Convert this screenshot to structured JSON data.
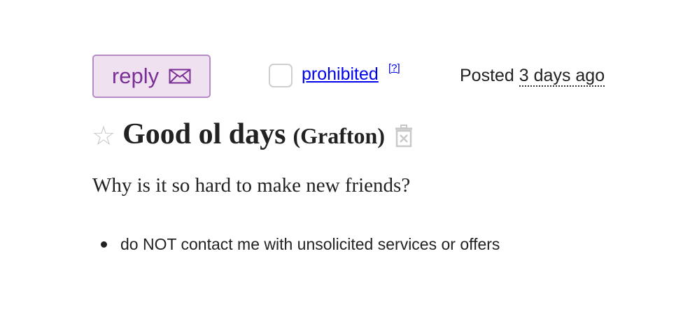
{
  "header": {
    "reply_label": "reply",
    "prohibited_label": "prohibited",
    "help_label": "[?]",
    "posted_prefix": "Posted",
    "posted_ago": "3 days ago"
  },
  "posting": {
    "title": "Good ol days",
    "location": "(Grafton)",
    "body": "Why is it so hard to make new friends?"
  },
  "notices": [
    "do NOT contact me with unsolicited services or offers"
  ],
  "icons": {
    "reply": "envelope-icon",
    "favorite": "star-icon",
    "hide": "trash-icon"
  },
  "colors": {
    "reply_bg": "#f0e1f0",
    "reply_border": "#b58bc6",
    "reply_text": "#7a2f96",
    "link": "#0000ee",
    "text": "#222222",
    "icon_gray": "#c8c8c8"
  }
}
